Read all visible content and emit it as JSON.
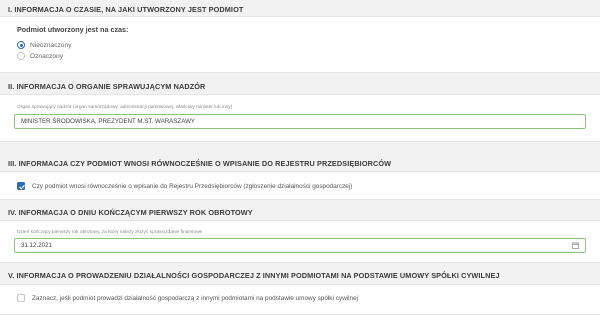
{
  "section1": {
    "header": "I. INFORMACJA O CZASIE, NA JAKI UTWORZONY JEST PODMIOT",
    "question": "Podmiot utworzony jest na czas:",
    "options": [
      {
        "label": "Nieoznaczony",
        "selected": true
      },
      {
        "label": "Oznaczony",
        "selected": false
      }
    ]
  },
  "section2": {
    "header": "II. INFORMACJA O ORGANIE SPRAWUJĄCYM NADZÓR",
    "field_label": "Organ sprawujący nadzór (organ samorządowy, administracji państwowej, właściwy minister lub inny)",
    "field_value": "MINISTER ŚRODOWISKA, PREZYDENT M.ST. WARASZAWY"
  },
  "section3": {
    "header": "III. INFORMACJA CZY PODMIOT WNOSI RÓWNOCZEŚNIE O WPISANIE DO REJESTRU PRZEDSIĘBIORCÓW",
    "checkbox_label": "Czy podmiot wnosi równocześnie o wpisanie do Rejestru Przedsiębiorców (zgłoszenie działalności gospodarczej)",
    "checked": true
  },
  "section4": {
    "header": "IV. INFORMACJA O DNIU KOŃCZĄCYM PIERWSZY ROK OBROTOWY",
    "field_label": "Dzień kończący pierwszy rok obrotowy, za który należy złożyć sprawozdanie finansowe",
    "field_value": "31.12.2021",
    "icon": "calendar-icon"
  },
  "section5": {
    "header": "V. INFORMACJA O PROWADZENIU DZIAŁALNOŚCI GOSPODARCZEJ Z INNYMI PODMIOTAMI NA PODSTAWIE UMOWY SPÓŁKI CYWILNEJ",
    "checkbox_label": "Zaznacz, jeśli podmiot prowadzi działalność gospodarczą z innymi podmiotami na podstawie umowy spółki cywilnej",
    "checked": false
  },
  "colors": {
    "accent": "#2a6ebb",
    "field_border": "#8fc27e",
    "background": "#f2f2f2"
  }
}
